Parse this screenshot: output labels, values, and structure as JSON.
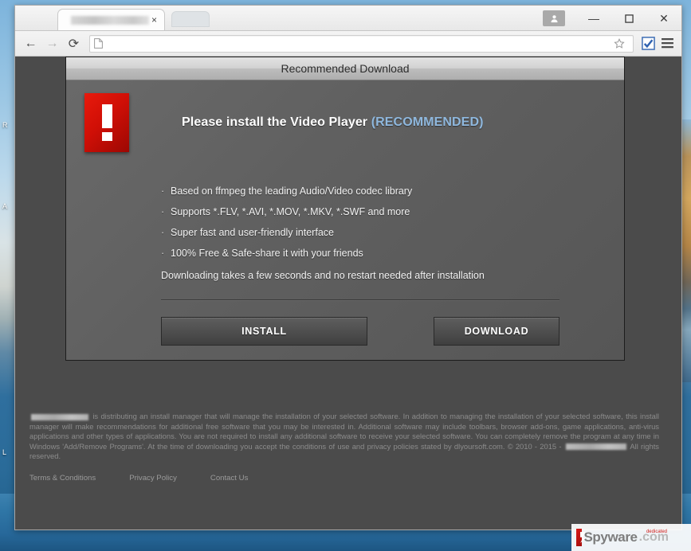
{
  "browser": {
    "tab": {
      "title_redacted": true,
      "close_label": "×"
    },
    "new_tab_label": "",
    "window_controls": {
      "profile_icon": "user-icon",
      "minimize": "—",
      "maximize": "☐",
      "close": "✕"
    },
    "toolbar": {
      "back": "←",
      "forward": "→",
      "reload": "⟳",
      "page_icon": "document-icon",
      "address_value": "",
      "address_placeholder": "",
      "bookmark_icon": "star-icon",
      "extension_icon": "checkbox-extension-icon",
      "menu_icon": "hamburger-menu-icon"
    }
  },
  "dialog": {
    "title": "Recommended Download",
    "alert_icon": "exclamation-icon",
    "headline_main": "Please install the Video Player ",
    "headline_recommended": "(RECOMMENDED)",
    "features": [
      "Based on ffmpeg the leading Audio/Video codec library",
      "Supports *.FLV, *.AVI, *.MOV, *.MKV, *.SWF and more",
      "Super fast and user-friendly interface",
      "100% Free & Safe-share it with your friends"
    ],
    "bullet_mark": "·",
    "note": "Downloading takes a few seconds and no restart needed after installation",
    "buttons": {
      "install": "INSTALL",
      "download": "DOWNLOAD"
    }
  },
  "legal": {
    "part1": " is distributing an install manager that will manage the installation of your selected software. In addition to managing the installation of your selected software, this install manager will make recommendations for additional free software that you may be interested in. Additional software may include toolbars, browser add-ons, game applications, anti-virus applications and other types of applications. You are not required to install any additional software to receive your selected software. You can completely remove the program at any time in Windows 'Add/Remove Programs'. At the time of downloading you accept the conditions of use and privacy policies stated by dlyoursoft.com. © 2010 - 2015 - ",
    "part2": " All rights reserved."
  },
  "footer_links": [
    "Terms & Conditions",
    "Privacy Policy",
    "Contact Us"
  ],
  "watermark": {
    "brand": "Spyware",
    "domain": ".com",
    "tagline": "dedicated"
  },
  "desktop_icons": [
    "R",
    "A",
    "L"
  ],
  "colors": {
    "alert_red": "#d00f06",
    "recommended_blue": "#8fb8de",
    "dialog_gray": "#606060",
    "page_gray": "#4b4b4b"
  }
}
